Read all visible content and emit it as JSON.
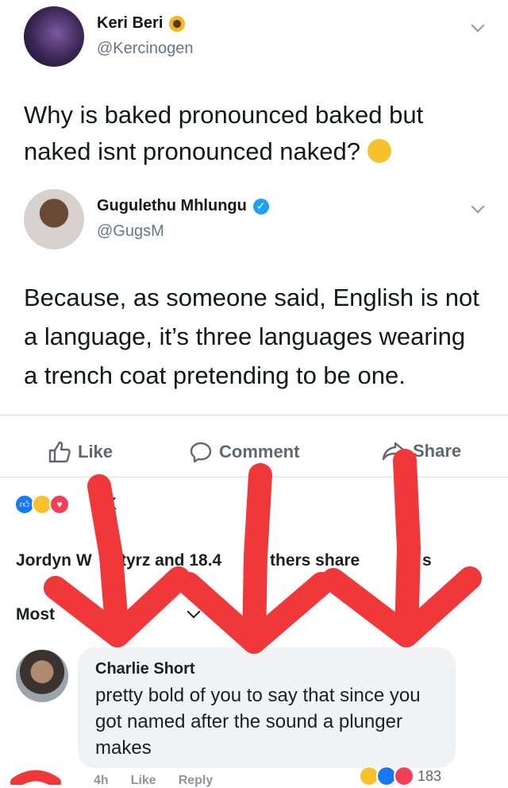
{
  "tweet1": {
    "name": "Keri Beri",
    "name_emoji": "sunflower-emoji",
    "handle": "@Kercinogen",
    "text": "Why is baked pronounced baked but naked isnt pronounced naked?",
    "emoji": "thinking-face-emoji"
  },
  "tweet2": {
    "name": "Gugulethu Mhlungu",
    "verified": true,
    "handle": "@GugsM",
    "text": "Because, as someone said, English is not a language, it’s three languages wearing a trench coat pretending to be one."
  },
  "actions": {
    "like": "Like",
    "comment": "Comment",
    "share": "Share"
  },
  "reactions": {
    "count": "K",
    "icons": [
      "like-reaction-icon",
      "haha-reaction-icon",
      "love-reaction-icon"
    ]
  },
  "shares": {
    "part1": "Jordyn W",
    "part2": "tyrz and 18.4",
    "part3": "thers share",
    "part4": "s"
  },
  "sort": {
    "label": "Most"
  },
  "comment": {
    "author": "Charlie Short",
    "text": "pretty bold of you to say that since you got named after the sound a plunger makes",
    "time": "4h",
    "like": "Like",
    "reply": "Reply",
    "reaction_count": "183"
  },
  "overlay": {
    "color": "#f0373a",
    "shape": "red-hand-drawn-arrows"
  }
}
